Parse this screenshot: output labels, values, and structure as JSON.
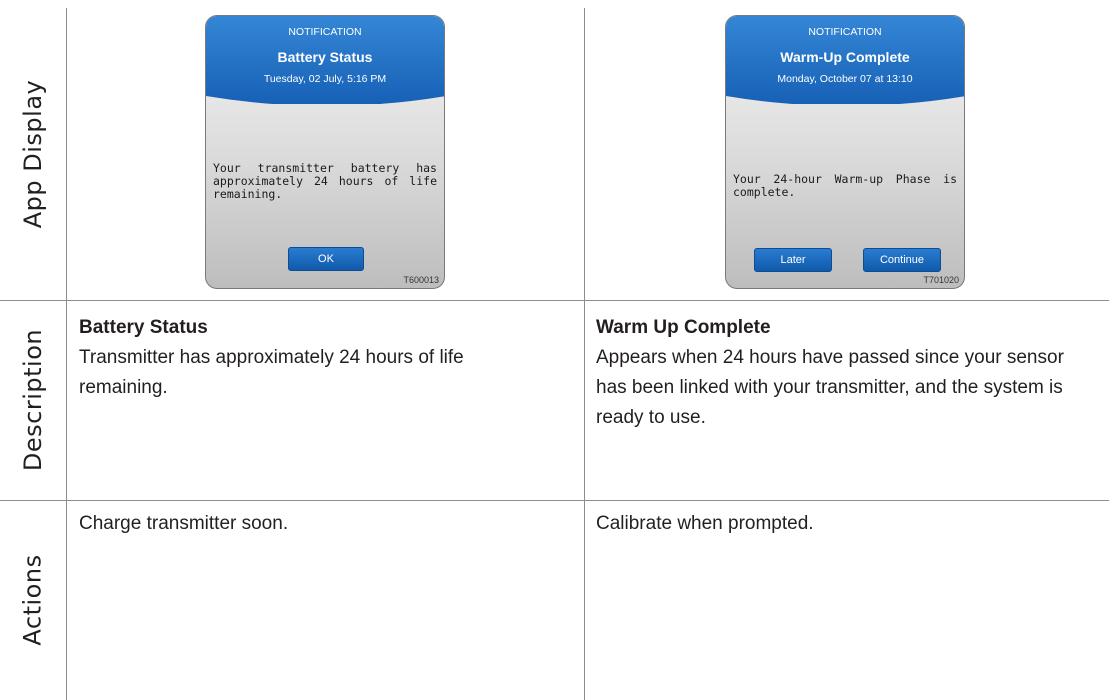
{
  "row_labels": {
    "app_display": "App Display",
    "description": "Description",
    "actions": "Actions"
  },
  "columns": [
    {
      "screen": {
        "notification_label": "NOTIFICATION",
        "title": "Battery Status",
        "date": "Tuesday, 02 July, 5:16 PM",
        "message": "Your transmitter battery has approximately 24 hours of life remaining.",
        "buttons": [
          "OK"
        ],
        "code": "T600013",
        "header_color": "#1f6fc4",
        "button_color": "#1666bb"
      },
      "description_title": "Battery Status",
      "description_body": "Transmitter has approximately 24 hours of life remaining.",
      "actions": "Charge transmitter soon."
    },
    {
      "screen": {
        "notification_label": "NOTIFICATION",
        "title": "Warm-Up Complete",
        "date": "Monday, October 07 at 13:10",
        "message": "Your 24-hour Warm-up Phase is complete.",
        "buttons": [
          "Later",
          "Continue"
        ],
        "code": "T701020",
        "header_color": "#1f6fc4",
        "button_color": "#1666bb"
      },
      "description_title": "Warm Up Complete",
      "description_body": "Appears when 24 hours have passed since your sensor has been linked with your transmitter, and the system is ready to use.",
      "actions": "Calibrate when prompted."
    }
  ]
}
